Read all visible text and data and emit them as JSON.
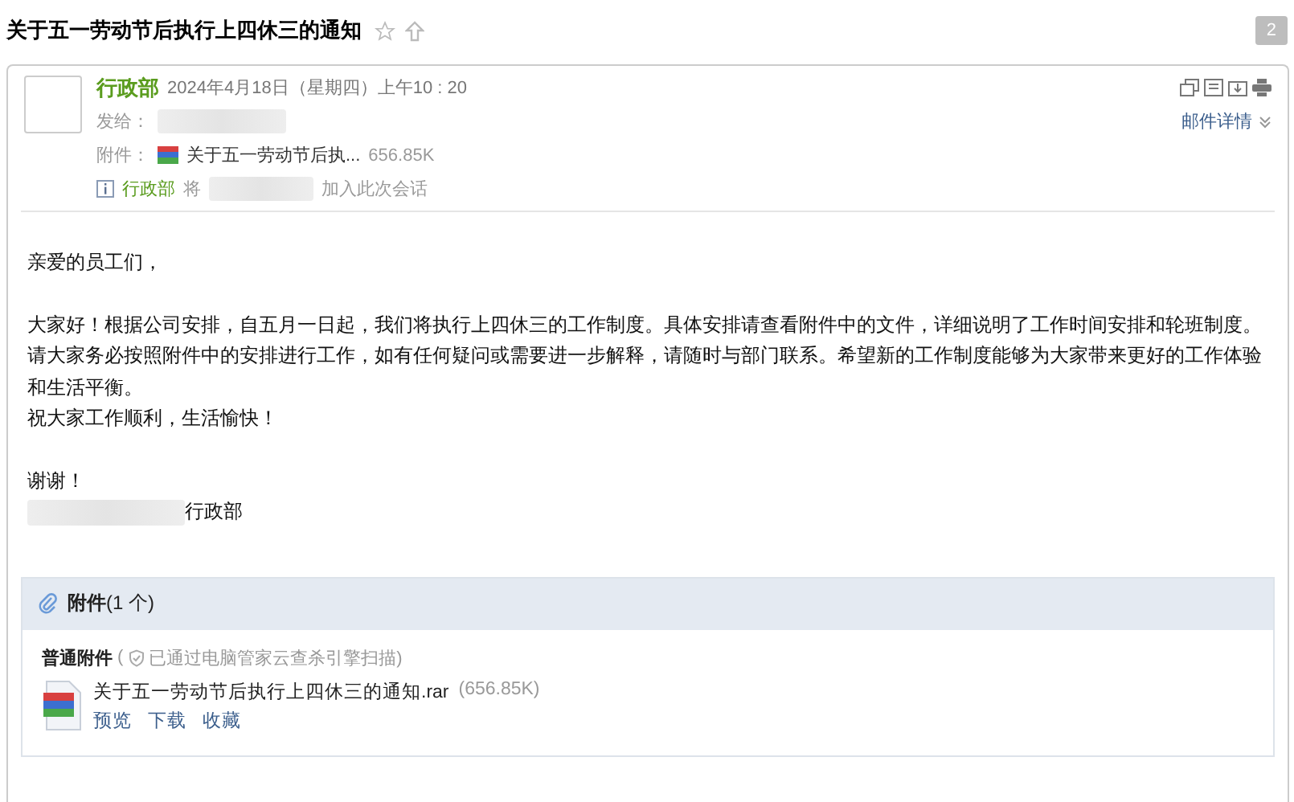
{
  "subject": "关于五一劳动节后执行上四休三的通知",
  "starred": false,
  "count": "2",
  "sender": {
    "name": "行政部",
    "time": "2024年4月18日（星期四）上午10 : 20"
  },
  "to_label": "发给：",
  "attachment_line": {
    "label": "附件：",
    "name": "关于五一劳动节后执...",
    "size": "656.85K"
  },
  "notice": {
    "name": "行政部",
    "verb": "将",
    "action": "加入此次会话"
  },
  "details_link": "邮件详情",
  "body": {
    "greeting": "亲爱的员工们，",
    "paragraphs": [
      "大家好！根据公司安排，自五月一日起，我们将执行上四休三的工作制度。具体安排请查看附件中的文件，详细说明了工作时间安排和轮班制度。",
      "请大家务必按照附件中的安排进行工作，如有任何疑问或需要进一步解释，请随时与部门联系。希望新的工作制度能够为大家带来更好的工作体验和生活平衡。",
      "祝大家工作顺利，生活愉快！"
    ],
    "thanks": "谢谢！",
    "signature": "行政部"
  },
  "attachments": {
    "title": "附件",
    "count": "(1 个)",
    "group": "普通附件",
    "scan_open": "(",
    "scan": "已通过电脑管家云查杀引擎扫描)",
    "files": [
      {
        "name": "关于五一劳动节后执行上四休三的通知.rar",
        "size": "(656.85K)",
        "actions": [
          "预览",
          "下载",
          "收藏"
        ]
      }
    ]
  }
}
